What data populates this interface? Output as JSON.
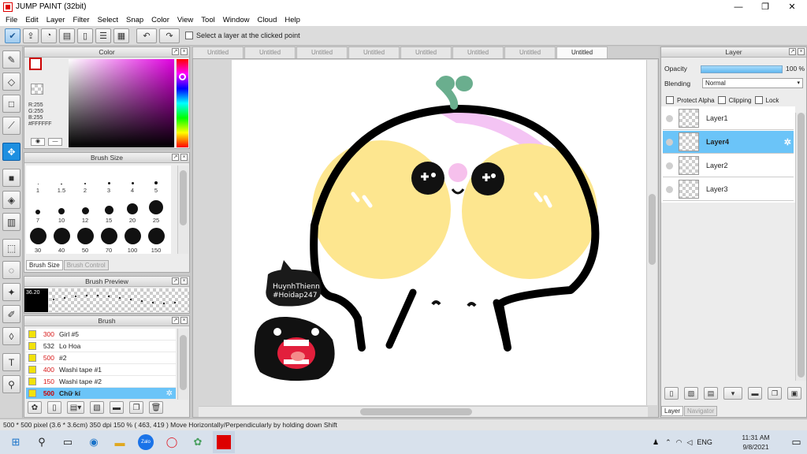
{
  "window": {
    "title": "JUMP PAINT (32bit)",
    "minimize": "—",
    "maximize": "❐",
    "close": "✕"
  },
  "menu": [
    "File",
    "Edit",
    "Layer",
    "Filter",
    "Select",
    "Snap",
    "Color",
    "View",
    "Tool",
    "Window",
    "Cloud",
    "Help"
  ],
  "toolbar": {
    "select_layer_label": "Select a layer at the clicked point"
  },
  "panels": {
    "color": {
      "title": "Color",
      "r": "R:255",
      "g": "G:255",
      "b": "B:255",
      "hex": "#FFFFFF",
      "fg_color": "#ffffff",
      "bg_color": "#ffffff"
    },
    "brush_size": {
      "title": "Brush Size",
      "sizes": [
        "1",
        "1.5",
        "2",
        "3",
        "4",
        "5",
        "7",
        "10",
        "12",
        "15",
        "20",
        "25",
        "30",
        "40",
        "50",
        "70",
        "100",
        "150"
      ],
      "tabs": [
        "Brush Size",
        "Brush Control"
      ]
    },
    "brush_preview": {
      "title": "Brush Preview",
      "value": "36.20"
    },
    "brush": {
      "title": "Brush",
      "items": [
        {
          "size": "300",
          "name": "Girl #5"
        },
        {
          "size": "532",
          "name": "Lo Hoa"
        },
        {
          "size": "500",
          "name": "#2"
        },
        {
          "size": "400",
          "name": "Washi tape #1"
        },
        {
          "size": "150",
          "name": "Washi tape #2"
        },
        {
          "size": "500",
          "name": "Chữ kí"
        }
      ],
      "selected_index": 5
    },
    "layer": {
      "title": "Layer",
      "opacity_label": "Opacity",
      "opacity_value": "100 %",
      "blending_label": "Blending",
      "blending_value": "Normal",
      "protect_alpha": "Protect Alpha",
      "clipping": "Clipping",
      "lock": "Lock",
      "layers": [
        "Layer1",
        "Layer4",
        "Layer2",
        "Layer3"
      ],
      "selected_index": 1,
      "tabs": [
        "Layer",
        "Navigator"
      ]
    }
  },
  "doc_tabs": [
    "Untitled",
    "Untitled",
    "Untitled",
    "Untitled",
    "Untitled",
    "Untitled",
    "Untitled",
    "Untitled"
  ],
  "active_doc_tab": 7,
  "canvas": {
    "sticker_text_line1": "HuynhThienn",
    "sticker_text_line2": "#Hoidap247"
  },
  "status": "500 * 500 pixel   (3.6 * 3.6cm)   350 dpi   150 %   ( 463, 419 )   Move Horizontally/Perpendicularly by holding down Shift",
  "taskbar": {
    "language": "ENG",
    "time": "11:31 AM",
    "date": "9/8/2021",
    "zalo_label": "Zalo"
  }
}
